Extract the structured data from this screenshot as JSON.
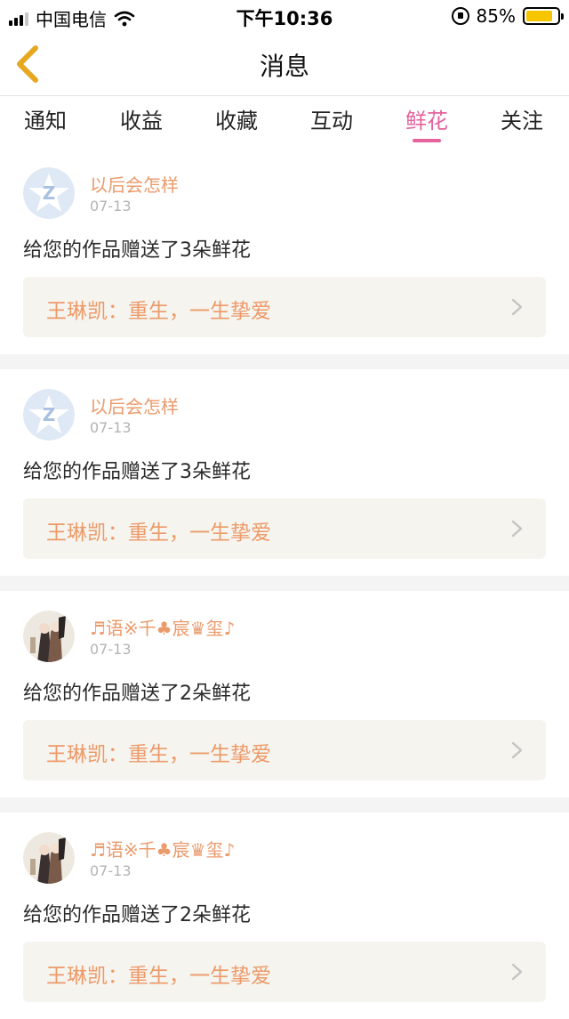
{
  "status_bar": {
    "carrier": "中国电信",
    "time": "下午10:36",
    "battery_text": "85%",
    "battery_level": 0.85,
    "battery_color": "#f6c500"
  },
  "nav": {
    "back_icon": "chevron-left-icon",
    "title": "消息",
    "accent_color": "#e5a820"
  },
  "tabs": [
    {
      "label": "通知",
      "active": false
    },
    {
      "label": "收益",
      "active": false
    },
    {
      "label": "收藏",
      "active": false
    },
    {
      "label": "互动",
      "active": false
    },
    {
      "label": "鲜花",
      "active": true
    },
    {
      "label": "关注",
      "active": false
    }
  ],
  "colors": {
    "active_tab": "#e5629d",
    "username": "#ea9a6b",
    "work_title": "#ec9a6a"
  },
  "messages": [
    {
      "username": "以后会怎样",
      "date": "07-13",
      "text": "给您的作品赠送了3朵鲜花",
      "work": "王琳凯：重生，一生挚爱",
      "avatar": "default-star-avatar"
    },
    {
      "username": "以后会怎样",
      "date": "07-13",
      "text": "给您的作品赠送了3朵鲜花",
      "work": "王琳凯：重生，一生挚爱",
      "avatar": "default-star-avatar"
    },
    {
      "username": "♬语※千♣宸♛玺♪",
      "date": "07-13",
      "text": "给您的作品赠送了2朵鲜花",
      "work": "王琳凯：重生，一生挚爱",
      "avatar": "illustrated-avatar"
    },
    {
      "username": "♬语※千♣宸♛玺♪",
      "date": "07-13",
      "text": "给您的作品赠送了2朵鲜花",
      "work": "王琳凯：重生，一生挚爱",
      "avatar": "illustrated-avatar"
    }
  ]
}
